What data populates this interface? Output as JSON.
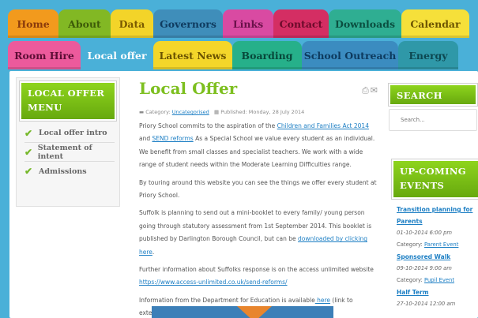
{
  "nav": {
    "row1": [
      {
        "label": "Home",
        "bg": "#f29a1d",
        "fg": "#8a3a0b"
      },
      {
        "label": "About",
        "bg": "#82b824",
        "fg": "#3d5b08"
      },
      {
        "label": "Data",
        "bg": "#f3d429",
        "fg": "#7a5a00"
      },
      {
        "label": "Governors",
        "bg": "#3f8eba",
        "fg": "#0f3c60"
      },
      {
        "label": "Links",
        "bg": "#d94aa2",
        "fg": "#6a1049"
      },
      {
        "label": "Contact",
        "bg": "#d42e63",
        "fg": "#6b0a2a"
      },
      {
        "label": "Downloads",
        "bg": "#2fae92",
        "fg": "#0a4f40"
      },
      {
        "label": "Calendar",
        "bg": "#f6e03a",
        "fg": "#6b5300"
      }
    ],
    "row2": [
      {
        "label": "Room Hire",
        "bg": "#ec5a9c",
        "fg": "#5d0d35"
      },
      {
        "label": "Local offer",
        "bg": "#4ab0d8",
        "fg": "#ffffff"
      },
      {
        "label": "Latest News",
        "bg": "#f4d62a",
        "fg": "#6b5300"
      },
      {
        "label": "Boarding",
        "bg": "#26b08a",
        "fg": "#07483a"
      },
      {
        "label": "School Outreach",
        "bg": "#3b8cc0",
        "fg": "#0d3a5e"
      },
      {
        "label": "Energy",
        "bg": "#2f98a8",
        "fg": "#0c4750"
      }
    ]
  },
  "left_menu": {
    "title": "LOCAL OFFER MENU",
    "items": [
      {
        "label": "Local offer intro"
      },
      {
        "label": "Statement of intent"
      },
      {
        "label": "Admissions"
      }
    ]
  },
  "article": {
    "title": "Local Offer",
    "meta_category_label": "Category:",
    "meta_category": "Uncategorised",
    "meta_published": "Published: Monday, 28 July 2014",
    "p1_a": "Priory School commits to the aspiration of the ",
    "p1_link1": "Children and Families Act 2014",
    "p1_b": " and ",
    "p1_link2": "SEND reforms",
    "p1_c": " As a Special School we value every student as an individual. We benefit from small classes and specialist teachers. We work with a wide range of student needs within the Moderate Learning Difficulties range.",
    "p2": "By touring around this website you can see the things we offer every student at Priory School.",
    "p3_a": "Suffolk is planning to send out a mini-booklet to every family/ young person going through statutory assessment from 1st September 2014. This booklet is published by Darlington Borough Council, but can be ",
    "p3_link": "downloaded by clicking here",
    "p3_b": ".",
    "p4_a": "Further information about Suffolks response is on the access unlimited website ",
    "p4_link": "https://www.access-unlimited.co.uk/send-reforms/",
    "p5_a": "Information from the Department for Education is available",
    "p5_link": " here",
    "p5_b": " (link to external website)"
  },
  "search": {
    "title": "SEARCH",
    "placeholder": "Search..."
  },
  "events": {
    "title": "UP-COMING EVENTS",
    "category_label": "Category:",
    "items": [
      {
        "title": "Transition planning for Parents",
        "date": "01-10-2014 6:00 pm",
        "category": "Parent Event"
      },
      {
        "title": "Sponsored Walk",
        "date": "09-10-2014 9:00 am",
        "category": "Pupil Event"
      },
      {
        "title": "Half Term",
        "date": "27-10-2014 12:00 am"
      }
    ]
  },
  "icons": {
    "check": "check-icon",
    "print": "print-icon",
    "email": "email-icon",
    "folder": "folder-icon",
    "calendar": "calendar-icon"
  }
}
